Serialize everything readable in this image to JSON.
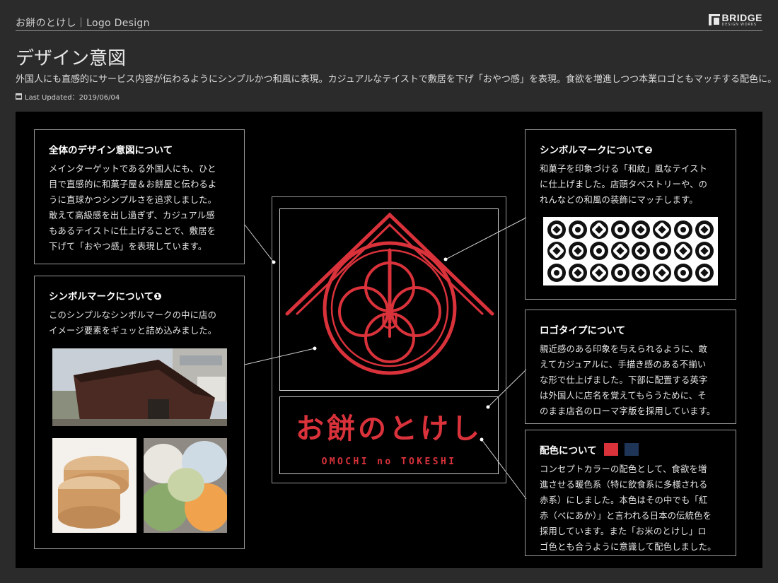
{
  "header": {
    "crumb": "お餅のとけし｜Logo Design",
    "brand_name": "BRIDGE",
    "brand_sub": "DESIGN WORKS"
  },
  "page": {
    "title": "デザイン意図",
    "intro": "外国人にも直感的にサービス内容が伝わるようにシンプルかつ和風に表現。カジュアルなテイストで敷居を下げ「おやつ感」を表現。食欲を増進しつつ本業ロゴともマッチする配色に。",
    "updated": "Last Updated：2019/06/04"
  },
  "boxes": {
    "overall": {
      "title": "全体のデザイン意図について",
      "lines": [
        "メインターゲットである外国人にも、ひと",
        "目で直感的に和菓子屋＆お餅屋と伝わるよ",
        "うに直球かつシンプルさを追求しました。",
        "敢えて高級感を出し過ぎず、カジュアル感",
        "もあるテイストに仕上げることで、敷居を",
        "下げて「おやつ感」を表現しています。"
      ]
    },
    "symbol1": {
      "title": "シンボルマークについて❶",
      "lines": [
        "このシンプルなシンボルマークの中に店の",
        "イメージ要素をギュッと詰め込みました。"
      ]
    },
    "symbol2": {
      "title": "シンボルマークについて❷",
      "lines": [
        "和菓子を印象づける「和紋」風なテイスト",
        "に仕上げました。店頭タペストリーや、の",
        "れんなどの和風の装飾にマッチします。"
      ]
    },
    "logotype": {
      "title": "ロゴタイプについて",
      "lines": [
        "親近感のある印象を与えられるように、敢",
        "えてカジュアルに、手描き感のある不揃い",
        "な形で仕上げました。下部に配置する英字",
        "は外国人に店名を覚えてもらうために、そ",
        "のまま店名のローマ字版を採用しています。"
      ]
    },
    "colors": {
      "title": "配色について",
      "lines": [
        "コンセプトカラーの配色として、食欲を増",
        "進させる暖色系（特に飲食系に多様される",
        "赤系）にしました。本色はその中でも「紅",
        "赤（べにあか）」と言われる日本の伝統色を",
        "採用しています。また「お米のとけし」ロ",
        "ゴ色とも合うように意識して配色しました。"
      ]
    }
  },
  "logo": {
    "name_jp": "お餅のとけし",
    "name_en": "OMOCHI no TOKESHI"
  },
  "palette": {
    "red": "#d9323b",
    "navy": "#1f3558"
  }
}
